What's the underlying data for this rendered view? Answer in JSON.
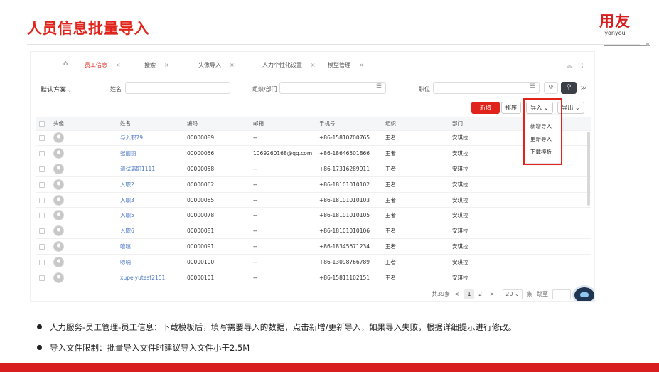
{
  "slide": {
    "title": "人员信息批量导入",
    "logo_main": "用友",
    "logo_sub": "yonyou",
    "bullets": [
      "人力服务-员工管理-员工信息：下载模板后，填写需要导入的数据，点击新增/更新导入，如果导入失败，根据详细提示进行修改。",
      "导入文件限制：批量导入文件时建议导入文件小于2.5M"
    ],
    "colors": {
      "brand": "#e0241b",
      "link": "#4a77c4"
    }
  },
  "app": {
    "tabs": [
      {
        "label": "员工信息",
        "active": true
      },
      {
        "label": "搜索"
      },
      {
        "label": "头像导入"
      },
      {
        "label": "人力个性化设置"
      },
      {
        "label": "模型管理"
      }
    ],
    "tab_close": "×",
    "icons": {
      "home": "home-icon",
      "collapse": "chevron-up-icon",
      "fullscreen": "fullscreen-icon"
    },
    "filter": {
      "scheme": "默认方案",
      "name_label": "姓名",
      "org_label": "组织/部门",
      "position_label": "职位"
    },
    "buttons": {
      "add": "新增",
      "sort": "排序",
      "import": "导入",
      "export": "导出"
    },
    "import_menu": [
      "新增导入",
      "更新导入",
      "下载模板"
    ],
    "table": {
      "columns": [
        "头像",
        "姓名",
        "编码",
        "邮箱",
        "手机号",
        "组织",
        "部门"
      ],
      "more": "···",
      "rows": [
        {
          "name": "与入职79",
          "code": "00000089",
          "email": "--",
          "phone": "+86-15810700765",
          "org": "王者",
          "dept": "安琪拉"
        },
        {
          "name": "张丽丽",
          "code": "00000056",
          "email": "1069260168@qq.com",
          "phone": "+86-18646501866",
          "org": "王者",
          "dept": "安琪拉"
        },
        {
          "name": "测试离职1111",
          "code": "00000058",
          "email": "--",
          "phone": "+86-17316289911",
          "org": "王者",
          "dept": "安琪拉"
        },
        {
          "name": "入职2",
          "code": "00000062",
          "email": "--",
          "phone": "+86-18101010102",
          "org": "王者",
          "dept": "安琪拉"
        },
        {
          "name": "入职3",
          "code": "00000065",
          "email": "--",
          "phone": "+86-18101010103",
          "org": "王者",
          "dept": "安琪拉"
        },
        {
          "name": "入职5",
          "code": "00000078",
          "email": "--",
          "phone": "+86-18101010105",
          "org": "王者",
          "dept": "安琪拉"
        },
        {
          "name": "入职6",
          "code": "00000081",
          "email": "--",
          "phone": "+86-18101010106",
          "org": "王者",
          "dept": "安琪拉"
        },
        {
          "name": "嘻嘻",
          "code": "00000091",
          "email": "--",
          "phone": "+86-18345671234",
          "org": "王者",
          "dept": "安琪拉"
        },
        {
          "name": "嗯呐",
          "code": "00000100",
          "email": "--",
          "phone": "+86-13098766789",
          "org": "王者",
          "dept": "安琪拉"
        },
        {
          "name": "xupeiyutest2151",
          "code": "00000101",
          "email": "--",
          "phone": "+86-15811102151",
          "org": "王者",
          "dept": "安琪拉"
        }
      ]
    },
    "pager": {
      "total": "共39条",
      "pages": [
        "1",
        "2"
      ],
      "current": "1",
      "page_size": "20",
      "unit": "条",
      "jump": "跳至"
    }
  }
}
